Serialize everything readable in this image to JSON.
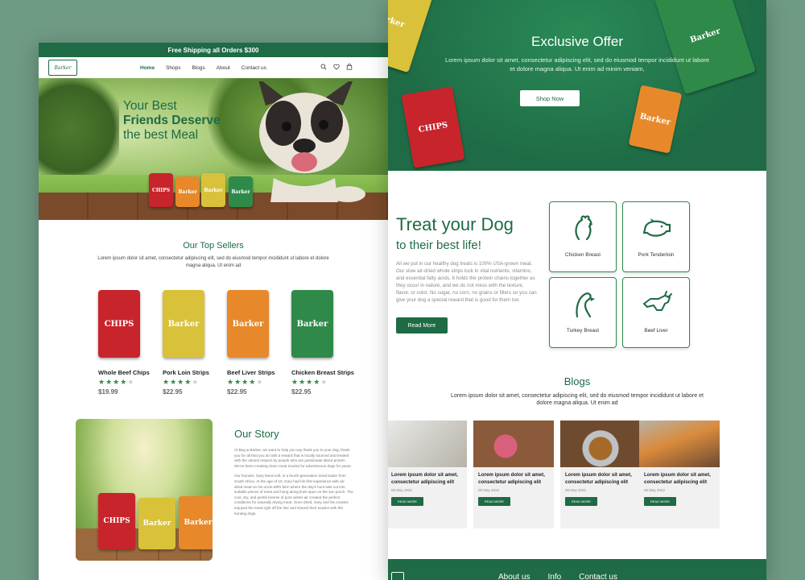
{
  "colors": {
    "brand_green": "#1e6b45",
    "background": "#6f9a84",
    "star": "#2f8a4a"
  },
  "left": {
    "shipping_text": "Free Shipping all Orders $300",
    "logo_text": "Barker",
    "nav": [
      "Home",
      "Shops",
      "Blogs",
      "About",
      "Contact us"
    ],
    "nav_active": "Home",
    "nav_icons": [
      "search-icon",
      "heart-icon",
      "bag-icon"
    ],
    "hero": {
      "line1": "Your Best",
      "line2": "Friends Deserve",
      "line3": "the best Meal",
      "packs": [
        "CHIPS",
        "Barker",
        "Barker",
        "Barker"
      ]
    },
    "top_sellers": {
      "title": "Our Top Sellers",
      "description": "Lorem ipsum dolor sit amet, consectetur adipiscing elit, sed do eiusmod tempor incididunt ut labore et dolore magna aliqua. Ut enim ad",
      "products": [
        {
          "name": "Whole Beef Chips",
          "pack_label": "CHIPS",
          "color": "#c8242c",
          "rating": 4,
          "price": "$19.99"
        },
        {
          "name": "Pork Loin Strips",
          "pack_label": "Barker",
          "color": "#d9c23a",
          "rating": 4,
          "price": "$22.95"
        },
        {
          "name": "Beef Liver Strips",
          "pack_label": "Barker",
          "color": "#e7892b",
          "rating": 4,
          "price": "$22.95"
        },
        {
          "name": "Chicken Breast Strips",
          "pack_label": "Barker",
          "color": "#2f8a4a",
          "rating": 4,
          "price": "$22.95"
        }
      ]
    },
    "story": {
      "title": "Our Story",
      "para1": "At Beg & Barker, we want to help you say thank you to your dog, thank you for all that you do with a reward that is locally sourced and treated with the utmost respect by people who are passionate about protein. We've been creating clean meat snacks for adventurous dogs for years.",
      "para2": "Our founder, Gary Moorcroft, is a fourth-generation meat trader from South Africa. At the age of 10, Gary had his first experience with air-dried meat on his uncle Bill's farm where the day's hunt was cut into suitable pieces of meat and hung along lines spun on the sun porch. The cool, dry, and gentle breeze of pure winter air created the perfect conditions for naturally drying meat. Once dried, Gary and his cousins enjoyed the meat right off the line and shared their snacks with the hunting dogs."
    }
  },
  "right": {
    "offer": {
      "title": "Exclusive Offer",
      "text": "Lorem ipsum dolor sit amet, consectetur adipiscing elit, sed do eiusmod tempor incididunt ut labore et dolore magna aliqua. Ut enim ad minim veniam,",
      "button": "Shop Now"
    },
    "treat": {
      "title": "Treat your Dog",
      "subtitle": "to their best life!",
      "text": "All we put in our healthy dog treats is 100% USA-grown meat. Our slow air-dried whole strips lock in vital nutrients, vitamins, and essential fatty acids. It holds the protein chains together as they occur in nature, and we do not mess with the texture, flavor, or color. No sugar, no corn, no grains or fillers so you can give your dog a special reward that is good for them too.",
      "button": "Read More"
    },
    "categories": [
      {
        "label": "Chicken Breast",
        "icon": "chicken-icon"
      },
      {
        "label": "Pork Tenderloin",
        "icon": "pig-icon"
      },
      {
        "label": "Turkey Breast",
        "icon": "turkey-icon"
      },
      {
        "label": "Beef Liver",
        "icon": "cow-icon"
      }
    ],
    "blogs": {
      "title": "Blogs",
      "description": "Lorem ipsum dolor sit amet, consectetur adipiscing elit, sed do eiusmod tempor incididunt ut labore et dolore magna aliqua. Ut enim ad",
      "cards": [
        {
          "title": "Lorem ipsum dolor sit amet, consectetur adipiscing elit",
          "date": "08 May 2022",
          "button": "READ MORE"
        },
        {
          "title": "Lorem ipsum dolor sit amet, consectetur adipiscing elit",
          "date": "08 May 2022",
          "button": "READ MORE"
        },
        {
          "title": "Lorem ipsum dolor sit amet, consectetur adipiscing elit",
          "date": "08 May 2022",
          "button": "READ MORE"
        },
        {
          "title": "Lorem ipsum dolor sit amet, consectetur adipiscing elit",
          "date": "08 May 2022",
          "button": "READ MORE"
        }
      ]
    },
    "footer": {
      "links": [
        "About us",
        "Info",
        "Contact us"
      ]
    }
  }
}
